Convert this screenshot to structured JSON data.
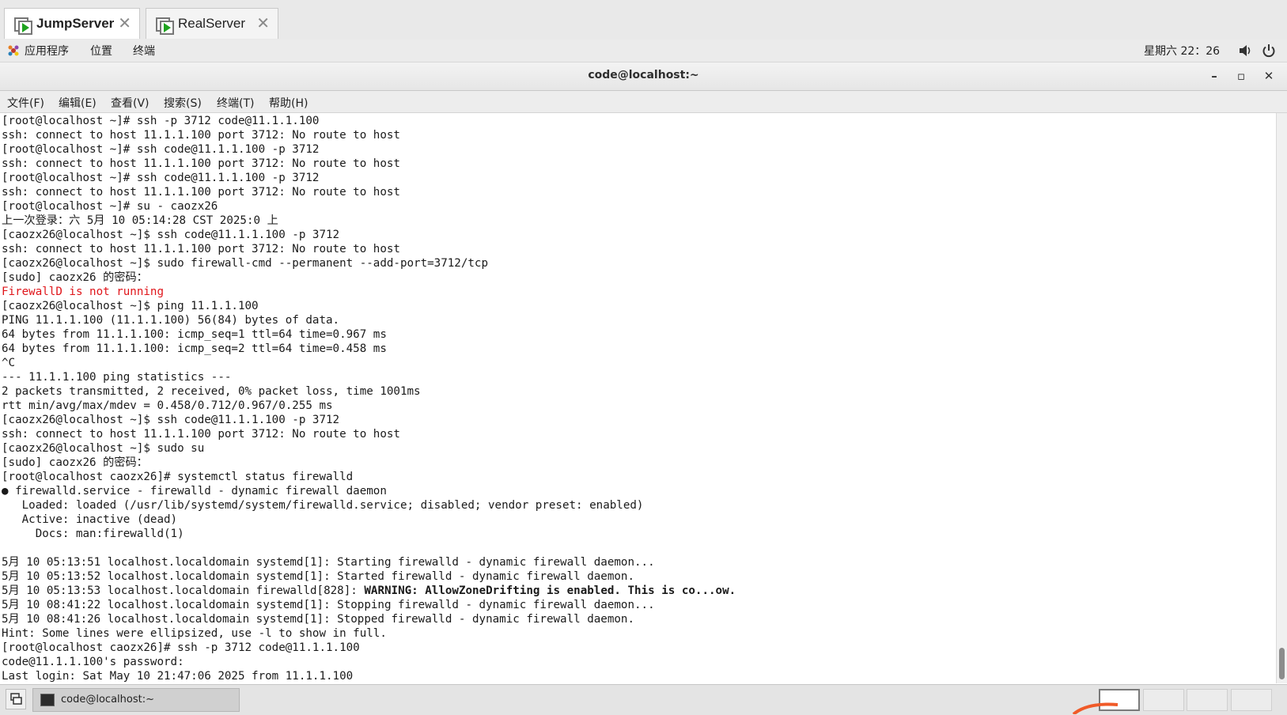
{
  "vm_tabs": [
    {
      "label": "JumpServer",
      "active": true
    },
    {
      "label": "RealServer",
      "active": false
    }
  ],
  "panel": {
    "apps": "应用程序",
    "places": "位置",
    "terminal": "终端",
    "clock": "星期六 22：26"
  },
  "window": {
    "title": "code@localhost:~",
    "minimize": "–",
    "maximize": "▫",
    "close": "✕"
  },
  "menu": [
    "文件(F)",
    "编辑(E)",
    "查看(V)",
    "搜索(S)",
    "终端(T)",
    "帮助(H)"
  ],
  "terminal_lines": [
    "[root@localhost ~]# ssh -p 3712 code@11.1.1.100",
    "ssh: connect to host 11.1.1.100 port 3712: No route to host",
    "[root@localhost ~]# ssh code@11.1.1.100 -p 3712",
    "ssh: connect to host 11.1.1.100 port 3712: No route to host",
    "[root@localhost ~]# ssh code@11.1.1.100 -p 3712",
    "ssh: connect to host 11.1.1.100 port 3712: No route to host",
    "[root@localhost ~]# su - caozx26",
    "上一次登录：六 5月 10 05:14:28 CST 2025:0 上",
    "[caozx26@localhost ~]$ ssh code@11.1.1.100 -p 3712",
    "ssh: connect to host 11.1.1.100 port 3712: No route to host",
    "[caozx26@localhost ~]$ sudo firewall-cmd --permanent --add-port=3712/tcp",
    "[sudo] caozx26 的密码：",
    "FirewallD is not running",
    "[caozx26@localhost ~]$ ping 11.1.1.100",
    "PING 11.1.1.100 (11.1.1.100) 56(84) bytes of data.",
    "64 bytes from 11.1.1.100: icmp_seq=1 ttl=64 time=0.967 ms",
    "64 bytes from 11.1.1.100: icmp_seq=2 ttl=64 time=0.458 ms",
    "^C",
    "--- 11.1.1.100 ping statistics ---",
    "2 packets transmitted, 2 received, 0% packet loss, time 1001ms",
    "rtt min/avg/max/mdev = 0.458/0.712/0.967/0.255 ms",
    "[caozx26@localhost ~]$ ssh code@11.1.1.100 -p 3712",
    "ssh: connect to host 11.1.1.100 port 3712: No route to host",
    "[caozx26@localhost ~]$ sudo su",
    "[sudo] caozx26 的密码：",
    "[root@localhost caozx26]# systemctl status firewalld",
    "● firewalld.service - firewalld - dynamic firewall daemon",
    "   Loaded: loaded (/usr/lib/systemd/system/firewalld.service; disabled; vendor preset: enabled)",
    "   Active: inactive (dead)",
    "     Docs: man:firewalld(1)",
    "",
    "5月 10 05:13:51 localhost.localdomain systemd[1]: Starting firewalld - dynamic firewall daemon...",
    "5月 10 05:13:52 localhost.localdomain systemd[1]: Started firewalld - dynamic firewall daemon.",
    "5月 10 05:13:53 localhost.localdomain firewalld[828]: ",
    "5月 10 08:41:22 localhost.localdomain systemd[1]: Stopping firewalld - dynamic firewall daemon...",
    "5月 10 08:41:26 localhost.localdomain systemd[1]: Stopped firewalld - dynamic firewall daemon.",
    "Hint: Some lines were ellipsized, use -l to show in full.",
    "[root@localhost caozx26]# ssh -p 3712 code@11.1.1.100",
    "code@11.1.1.100's password:",
    "Last login: Sat May 10 21:47:06 2025 from 11.1.1.100"
  ],
  "warning_text": "WARNING: AllowZoneDrifting is enabled. This is co...ow.",
  "taskbar": {
    "task_label": "code@localhost:~",
    "workspaces": 4,
    "active_workspace": 1
  },
  "colors": {
    "error_text": "#e0161b",
    "play_green": "#1ea31e"
  }
}
